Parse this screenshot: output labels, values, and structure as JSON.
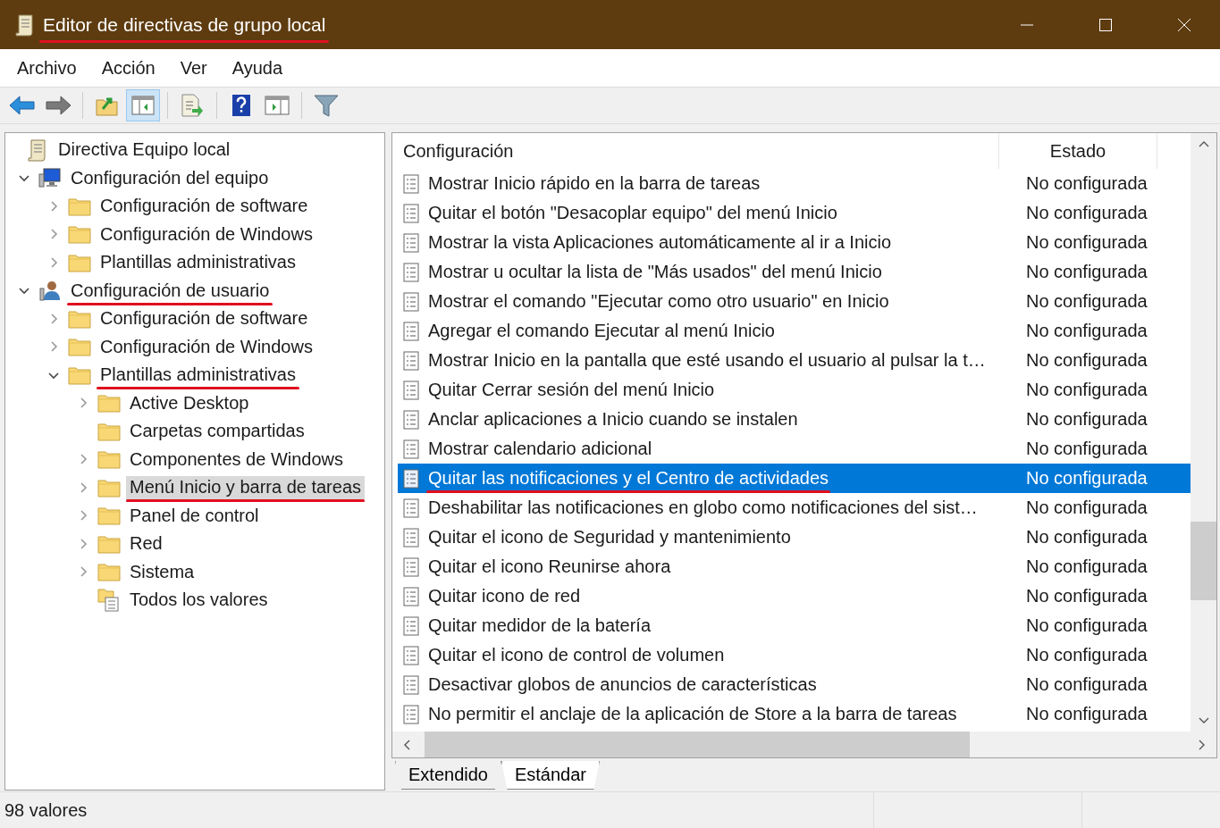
{
  "window": {
    "title": "Editor de directivas de grupo local",
    "title_annotated": true
  },
  "menu": [
    "Archivo",
    "Acción",
    "Ver",
    "Ayuda"
  ],
  "toolbar": [
    {
      "kind": "back",
      "pressed": false
    },
    {
      "kind": "forward",
      "pressed": false
    },
    {
      "kind": "sep"
    },
    {
      "kind": "up",
      "pressed": false
    },
    {
      "kind": "tree",
      "pressed": true
    },
    {
      "kind": "sep"
    },
    {
      "kind": "export",
      "pressed": false
    },
    {
      "kind": "sep"
    },
    {
      "kind": "help",
      "pressed": false
    },
    {
      "kind": "pane",
      "pressed": false
    },
    {
      "kind": "sep"
    },
    {
      "kind": "filter",
      "pressed": false
    }
  ],
  "tree": {
    "label": "Directiva Equipo local",
    "kind": "policy",
    "selected": false,
    "annotated": false,
    "children": [
      {
        "label": "Configuración del equipo",
        "kind": "computer",
        "expanded": true,
        "selected": false,
        "annotated": false,
        "children": [
          {
            "label": "Configuración de software",
            "kind": "folder",
            "expanded": false,
            "selected": false,
            "annotated": false
          },
          {
            "label": "Configuración de Windows",
            "kind": "folder",
            "expanded": false,
            "selected": false,
            "annotated": false
          },
          {
            "label": "Plantillas administrativas",
            "kind": "folder",
            "expanded": false,
            "selected": false,
            "annotated": false
          }
        ]
      },
      {
        "label": "Configuración de usuario",
        "kind": "user",
        "expanded": true,
        "selected": false,
        "annotated": true,
        "children": [
          {
            "label": "Configuración de software",
            "kind": "folder",
            "expanded": false,
            "selected": false,
            "annotated": false
          },
          {
            "label": "Configuración de Windows",
            "kind": "folder",
            "expanded": false,
            "selected": false,
            "annotated": false
          },
          {
            "label": "Plantillas administrativas",
            "kind": "folder",
            "expanded": true,
            "selected": false,
            "annotated": true,
            "children": [
              {
                "label": "Active Desktop",
                "kind": "folder",
                "expanded": false,
                "selected": false,
                "annotated": false
              },
              {
                "label": "Carpetas compartidas",
                "kind": "folder",
                "selected": false,
                "annotated": false
              },
              {
                "label": "Componentes de Windows",
                "kind": "folder",
                "expanded": false,
                "selected": false,
                "annotated": false
              },
              {
                "label": "Menú Inicio y barra de tareas",
                "kind": "folder",
                "expanded": false,
                "selected": true,
                "annotated": true
              },
              {
                "label": "Panel de control",
                "kind": "folder",
                "expanded": false,
                "selected": false,
                "annotated": false
              },
              {
                "label": "Red",
                "kind": "folder",
                "expanded": false,
                "selected": false,
                "annotated": false
              },
              {
                "label": "Sistema",
                "kind": "folder",
                "expanded": false,
                "selected": false,
                "annotated": false
              },
              {
                "label": "Todos los valores",
                "kind": "all",
                "selected": false,
                "annotated": false
              }
            ]
          }
        ]
      }
    ]
  },
  "list": {
    "columns": [
      "Configuración",
      "Estado"
    ],
    "rows": [
      {
        "setting": "Mostrar Inicio rápido en la barra de tareas",
        "state": "No configurada",
        "selected": false,
        "annotated": false
      },
      {
        "setting": "Quitar el botón \"Desacoplar equipo\" del menú Inicio",
        "state": "No configurada",
        "selected": false,
        "annotated": false
      },
      {
        "setting": "Mostrar la vista Aplicaciones automáticamente al ir a Inicio",
        "state": "No configurada",
        "selected": false,
        "annotated": false
      },
      {
        "setting": "Mostrar u ocultar la lista de \"Más usados\" del menú Inicio",
        "state": "No configurada",
        "selected": false,
        "annotated": false
      },
      {
        "setting": "Mostrar el comando \"Ejecutar como otro usuario\" en Inicio",
        "state": "No configurada",
        "selected": false,
        "annotated": false
      },
      {
        "setting": "Agregar el comando Ejecutar al menú Inicio",
        "state": "No configurada",
        "selected": false,
        "annotated": false
      },
      {
        "setting": "Mostrar Inicio en la pantalla que esté usando el usuario al pulsar la t…",
        "state": "No configurada",
        "selected": false,
        "annotated": false
      },
      {
        "setting": "Quitar Cerrar sesión del menú Inicio",
        "state": "No configurada",
        "selected": false,
        "annotated": false
      },
      {
        "setting": "Anclar aplicaciones a Inicio cuando se instalen",
        "state": "No configurada",
        "selected": false,
        "annotated": false
      },
      {
        "setting": "Mostrar calendario adicional",
        "state": "No configurada",
        "selected": false,
        "annotated": false
      },
      {
        "setting": "Quitar las notificaciones y el Centro de actividades",
        "state": "No configurada",
        "selected": true,
        "annotated": true
      },
      {
        "setting": "Deshabilitar las notificaciones en globo como notificaciones del sist…",
        "state": "No configurada",
        "selected": false,
        "annotated": false
      },
      {
        "setting": "Quitar el icono de Seguridad y mantenimiento",
        "state": "No configurada",
        "selected": false,
        "annotated": false
      },
      {
        "setting": "Quitar el icono Reunirse ahora",
        "state": "No configurada",
        "selected": false,
        "annotated": false
      },
      {
        "setting": "Quitar icono de red",
        "state": "No configurada",
        "selected": false,
        "annotated": false
      },
      {
        "setting": "Quitar medidor de la batería",
        "state": "No configurada",
        "selected": false,
        "annotated": false
      },
      {
        "setting": "Quitar el icono de control de volumen",
        "state": "No configurada",
        "selected": false,
        "annotated": false
      },
      {
        "setting": "Desactivar globos de anuncios de características",
        "state": "No configurada",
        "selected": false,
        "annotated": false
      },
      {
        "setting": "No permitir el anclaje de la aplicación de Store a la barra de tareas",
        "state": "No configurada",
        "selected": false,
        "annotated": false
      }
    ]
  },
  "tabs": [
    {
      "label": "Extendido",
      "selected": false
    },
    {
      "label": "Estándar",
      "selected": true
    }
  ],
  "status_bar": "98 valores"
}
